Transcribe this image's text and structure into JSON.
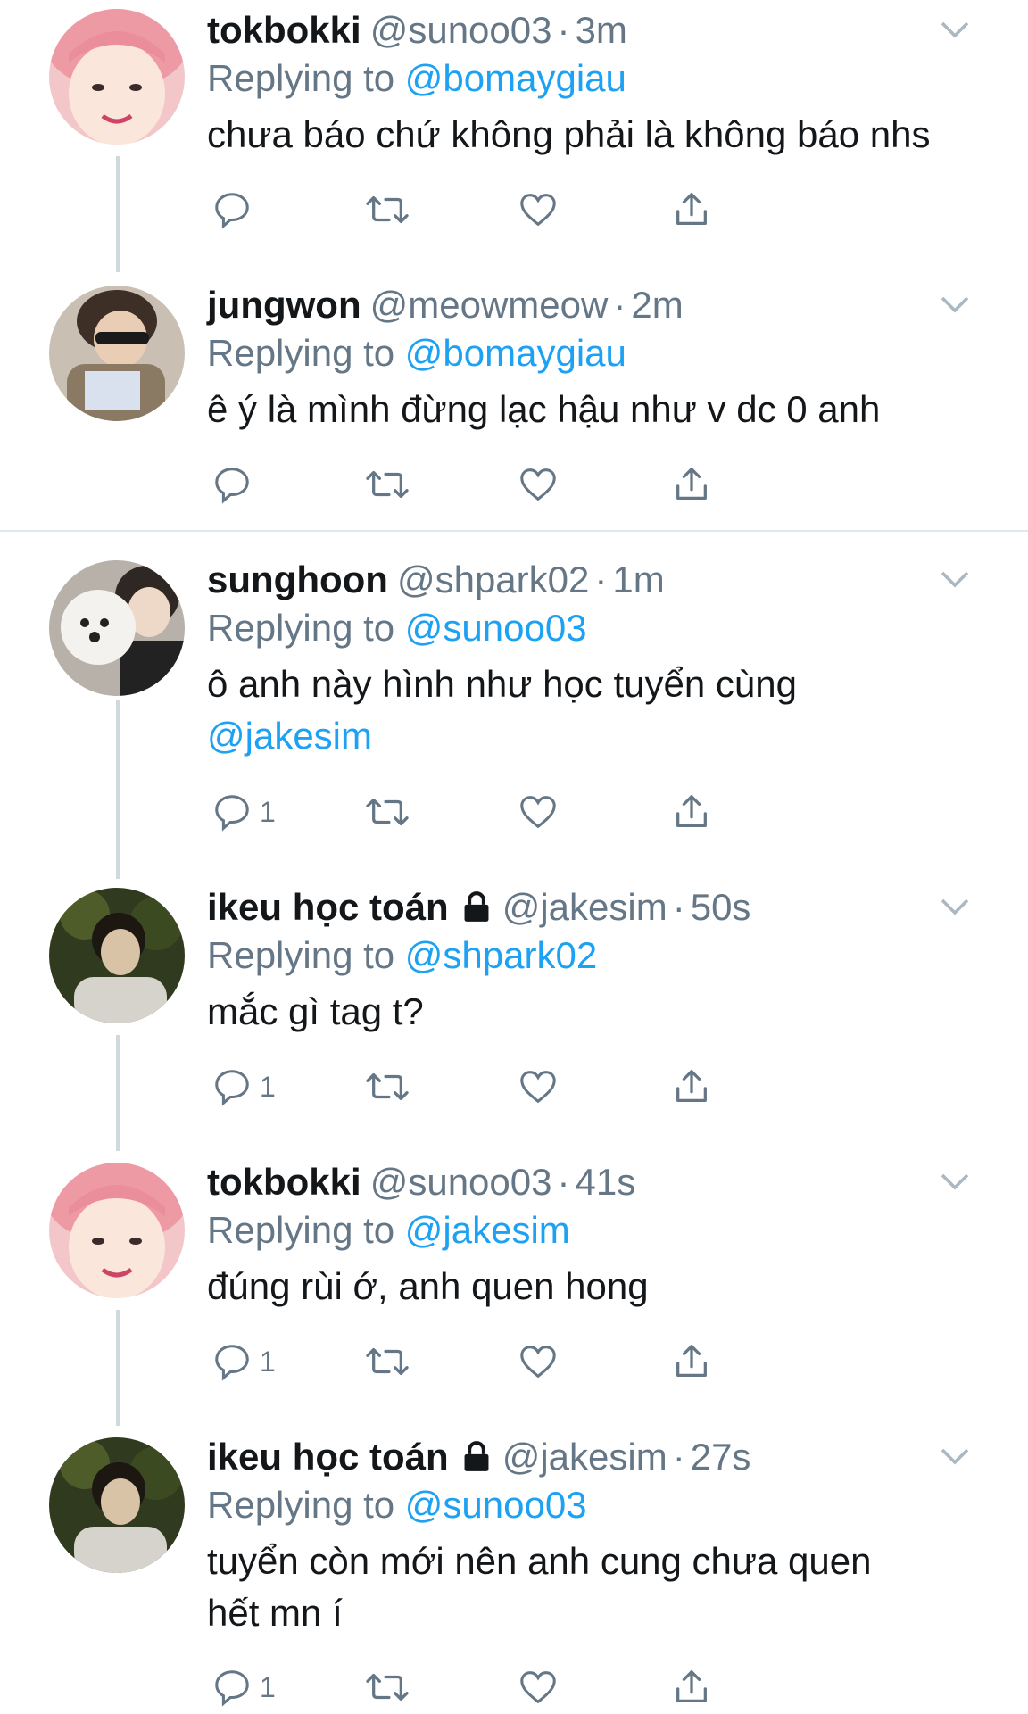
{
  "tweets": [
    {
      "name": "tokbokki",
      "handle": "@sunoo03",
      "time": "3m",
      "replying_label": "Replying to",
      "replying_to": "@bomaygiau",
      "text": "chưa báo chứ không phải là không báo nhs",
      "reply_count": "",
      "locked": false
    },
    {
      "name": "jungwon",
      "handle": "@meowmeow",
      "time": "2m",
      "replying_label": "Replying to",
      "replying_to": "@bomaygiau",
      "text": "ê ý là mình đừng lạc hậu như v dc 0 anh",
      "reply_count": "",
      "locked": false
    },
    {
      "name": "sunghoon",
      "handle": "@shpark02",
      "time": "1m",
      "replying_label": "Replying to",
      "replying_to": "@sunoo03",
      "text": "ô anh này hình như học tuyển cùng",
      "text_mention": "@jakesim",
      "reply_count": "1",
      "locked": false
    },
    {
      "name": "ikeu học toán",
      "handle": "@jakesim",
      "time": "50s",
      "replying_label": "Replying to",
      "replying_to": "@shpark02",
      "text": "mắc gì tag t?",
      "reply_count": "1",
      "locked": true
    },
    {
      "name": "tokbokki",
      "handle": "@sunoo03",
      "time": "41s",
      "replying_label": "Replying to",
      "replying_to": "@jakesim",
      "text": "đúng rùi ớ, anh quen hong",
      "reply_count": "1",
      "locked": false
    },
    {
      "name": "ikeu học toán",
      "handle": "@jakesim",
      "time": "27s",
      "replying_label": "Replying to",
      "replying_to": "@sunoo03",
      "text": "tuyển còn mới nên anh cung chưa quen",
      "text_line2": "hết mn í",
      "reply_count": "1",
      "locked": true
    }
  ],
  "colors": {
    "accent": "#1da1f2",
    "muted": "#657786",
    "text": "#14171a",
    "thread_line": "#cfd9de"
  },
  "icons": [
    "reply-icon",
    "retweet-icon",
    "like-icon",
    "share-icon",
    "chevron-down-icon",
    "lock-icon"
  ]
}
